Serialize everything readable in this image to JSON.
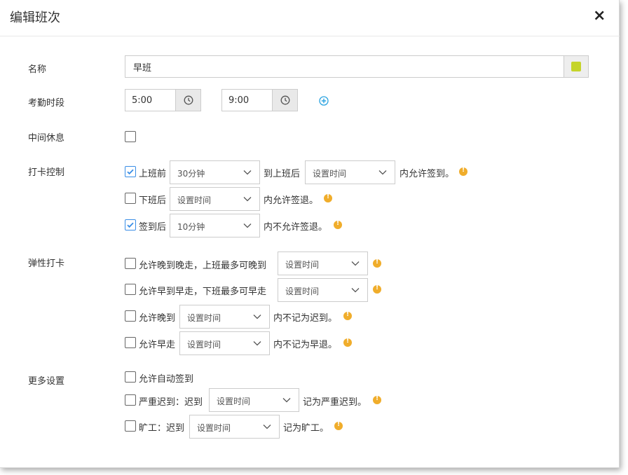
{
  "dialog": {
    "title": "编辑班次",
    "close": "×"
  },
  "form": {
    "name": {
      "label": "名称",
      "value": "早班",
      "color": "#c5d42a"
    },
    "period": {
      "label": "考勤时段",
      "start": "5:00",
      "end": "9:00"
    },
    "break": {
      "label": "中间休息",
      "checked": false
    },
    "punch": {
      "label": "打卡控制",
      "r1": {
        "checked": true,
        "a": "上班前",
        "sel1": "30分钟",
        "b": "到上班后",
        "sel2": "设置时间",
        "c": "内允许签到。"
      },
      "r2": {
        "checked": false,
        "a": "下班后",
        "sel": "设置时间",
        "c": "内允许签退。"
      },
      "r3": {
        "checked": true,
        "a": "签到后",
        "sel": "10分钟",
        "c": "内不允许签退。"
      }
    },
    "flex": {
      "label": "弹性打卡",
      "r1": {
        "checked": false,
        "a": "允许晚到晚走，上班最多可晚到",
        "sel": "设置时间"
      },
      "r2": {
        "checked": false,
        "a": "允许早到早走，下班最多可早走",
        "sel": "设置时间"
      },
      "r3": {
        "checked": false,
        "a": "允许晚到",
        "sel": "设置时间",
        "c": "内不记为迟到。"
      },
      "r4": {
        "checked": false,
        "a": "允许早走",
        "sel": "设置时间",
        "c": "内不记为早退。"
      }
    },
    "more": {
      "label": "更多设置",
      "r1": {
        "checked": false,
        "a": "允许自动签到"
      },
      "r2": {
        "checked": false,
        "a": "严重迟到：迟到",
        "sel": "设置时间",
        "c": "记为严重迟到。"
      },
      "r3": {
        "checked": false,
        "a": "旷工：迟到",
        "sel": "设置时间",
        "c": "记为旷工。"
      }
    }
  }
}
